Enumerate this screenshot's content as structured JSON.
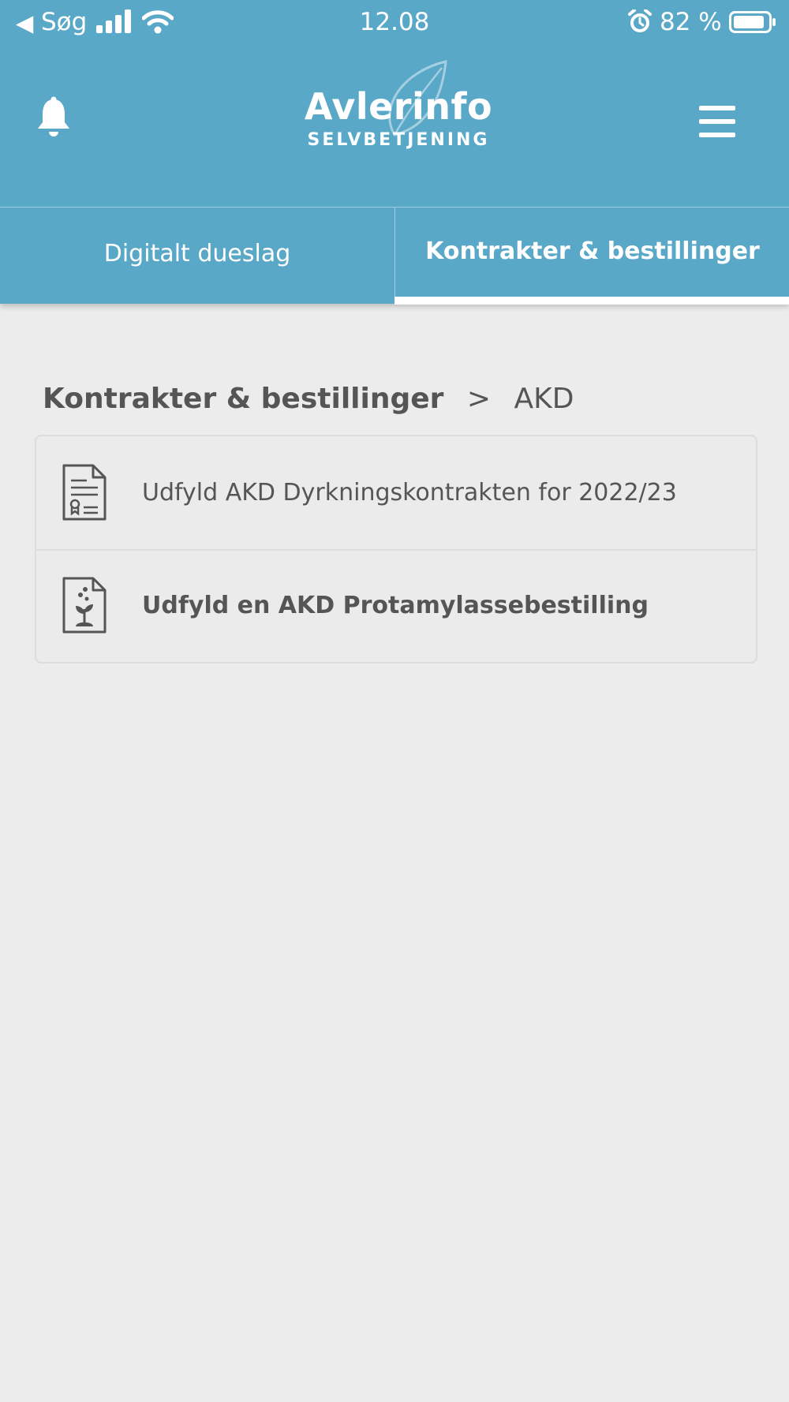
{
  "status_bar": {
    "back_glyph": "◀",
    "carrier": "Søg",
    "time": "12.08",
    "battery": "82 %",
    "icons": [
      "signal-icon",
      "wifi-icon",
      "alarm-icon",
      "battery-icon"
    ]
  },
  "header": {
    "brand_name": "Avlerinfo",
    "brand_sub": "SELVBETJENING",
    "icons": [
      "bell-icon",
      "menu-icon",
      "leaf-logo-icon"
    ],
    "background_color": "#5aa8c8"
  },
  "tabs": [
    {
      "label": "Digitalt dueslag",
      "active": false
    },
    {
      "label": "Kontrakter & bestillinger",
      "active": true
    }
  ],
  "breadcrumb": {
    "main": "Kontrakter & bestillinger",
    "separator": ">",
    "current": "AKD"
  },
  "list": {
    "items": [
      {
        "label": "Udfyld AKD Dyrkningskontrakten for 2022/23",
        "icon": "contract-document-icon",
        "bold": false
      },
      {
        "label": "Udfyld en AKD Protamylassebestilling",
        "icon": "plant-document-icon",
        "bold": true
      }
    ]
  },
  "colors": {
    "accent": "#5aa8c8",
    "background": "#ececec",
    "text": "#555555"
  }
}
